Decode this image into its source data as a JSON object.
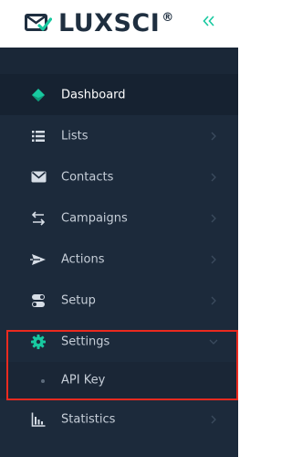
{
  "logo": {
    "text": "LUXSCI",
    "reg": "®"
  },
  "colors": {
    "sidebar_bg": "#1c2a3b",
    "active_bg": "#162231",
    "brand_green": "#18c9a0",
    "text": "#c6ced8",
    "highlight": "#ea2a1f",
    "logo_dark": "#1f2f40"
  },
  "menu": {
    "items": [
      {
        "label": "Dashboard",
        "icon": "diamond-icon",
        "active": true
      },
      {
        "label": "Lists",
        "icon": "list-icon"
      },
      {
        "label": "Contacts",
        "icon": "envelope-icon"
      },
      {
        "label": "Campaigns",
        "icon": "arrows-exchange-icon"
      },
      {
        "label": "Actions",
        "icon": "send-icon"
      },
      {
        "label": "Setup",
        "icon": "toggle-icon"
      },
      {
        "label": "Settings",
        "icon": "gear-icon",
        "expanded": true
      },
      {
        "label": "API Key",
        "submenu": true
      },
      {
        "label": "Statistics",
        "icon": "bar-chart-icon"
      }
    ]
  }
}
